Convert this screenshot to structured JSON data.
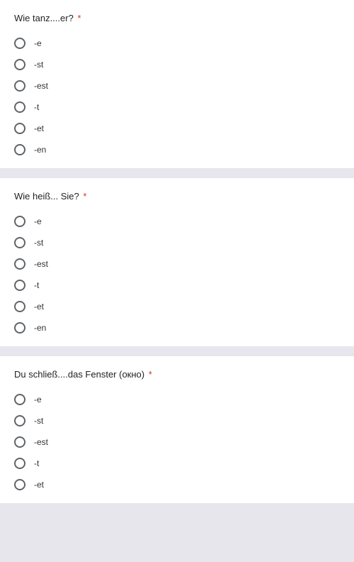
{
  "questions": [
    {
      "title": "Wie tanz....er?",
      "required": true,
      "options": [
        "-e",
        "-st",
        "-est",
        "-t",
        "-et",
        "-en"
      ]
    },
    {
      "title": "Wie heiß... Sie?",
      "required": true,
      "options": [
        "-e",
        "-st",
        "-est",
        "-t",
        "-et",
        "-en"
      ]
    },
    {
      "title": "Du schließ....das Fenster (окно)",
      "required": true,
      "options": [
        "-e",
        "-st",
        "-est",
        "-t",
        "-et"
      ]
    }
  ],
  "asterisk": "*"
}
